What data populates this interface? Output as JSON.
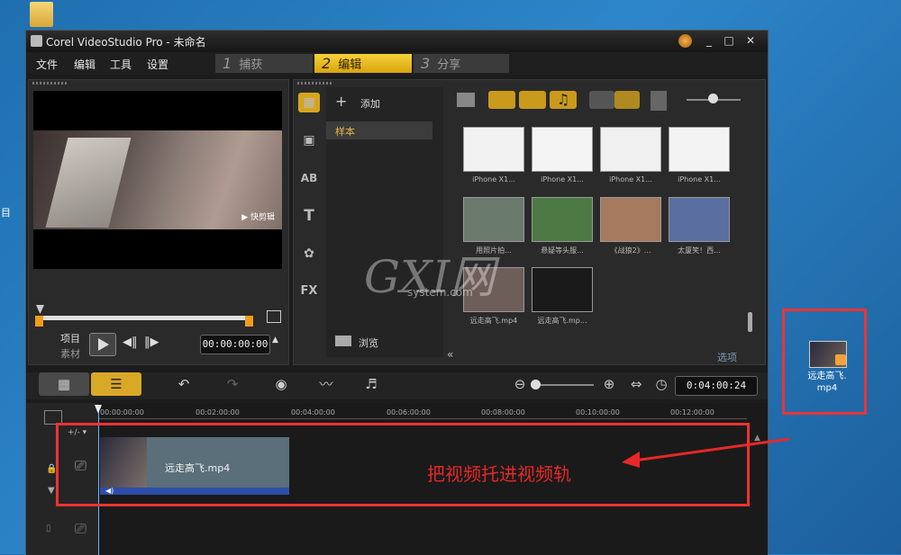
{
  "window": {
    "title": "Corel VideoStudio Pro - 未命名",
    "controls": [
      "_",
      "□",
      "✕"
    ]
  },
  "menu": [
    "文件",
    "编辑",
    "工具",
    "设置"
  ],
  "steps": [
    {
      "num": "1",
      "label": "捕获"
    },
    {
      "num": "2",
      "label": "编辑"
    },
    {
      "num": "3",
      "label": "分享"
    }
  ],
  "player": {
    "watermark": "▶ 快剪辑",
    "project_label": "项目",
    "clip_label": "素材",
    "timecode": "00:00:00:00"
  },
  "library": {
    "add_label": "添加",
    "folder": "样本",
    "browse_label": "浏览",
    "options_label": "选项"
  },
  "tool_icons": [
    "media-icon",
    "transition-icon",
    "title-icon",
    "text-icon",
    "graphics-icon",
    "filter-icon"
  ],
  "tool_glyphs": {
    "title": "AB",
    "text": "T",
    "filter": "FX"
  },
  "thumbnails": [
    {
      "label": "iPhone X1...",
      "bg": "#f2f2f2"
    },
    {
      "label": "iPhone X1...",
      "bg": "#f4f4f4"
    },
    {
      "label": "iPhone X1...",
      "bg": "#f0f0f0"
    },
    {
      "label": "iPhone X1...",
      "bg": "#f3f3f3"
    },
    {
      "label": "用照片拍...",
      "bg": "#6a7a6c"
    },
    {
      "label": "悬疑等头服...",
      "bg": "#4d7a44"
    },
    {
      "label": "《战狼2》...",
      "bg": "#a67a5e"
    },
    {
      "label": "太厦笑！西...",
      "bg": "#5a6fa0"
    },
    {
      "label": "远走高飞.mp4",
      "bg": "#6d5e5a"
    },
    {
      "label": "远走高飞.mp...",
      "bg": "#1a1a1a"
    }
  ],
  "timeline": {
    "total": "0:04:00:24",
    "ruler": [
      "00:00:00:00",
      "00:02:00:00",
      "00:04:00:00",
      "00:06:00:00",
      "00:08:00:00",
      "00:10:00:00",
      "00:12:00:00"
    ],
    "clip_name": "远走高飞.mp4"
  },
  "annotation": "把视频托进视频轨",
  "desktop_file": {
    "name_line1": "远走高飞.",
    "name_line2": "mp4"
  },
  "watermark_site": {
    "brand": "GXI网",
    "sub": "system.com"
  },
  "desktop_edge_text": [
    "目"
  ]
}
